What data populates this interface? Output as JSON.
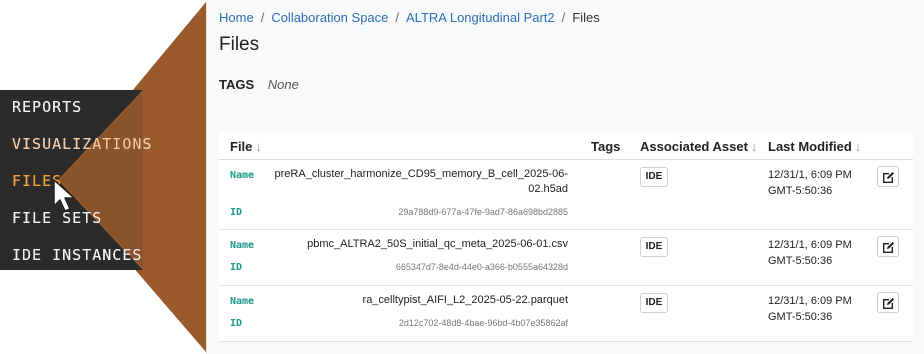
{
  "menu": {
    "items": [
      {
        "label": "REPORTS",
        "state": "normal"
      },
      {
        "label": "VISUALIZATIONS",
        "state": "faded"
      },
      {
        "label": "FILES",
        "state": "active"
      },
      {
        "label": "FILE SETS",
        "state": "normal"
      },
      {
        "label": "IDE INSTANCES",
        "state": "normal"
      }
    ]
  },
  "breadcrumb": {
    "items": [
      "Home",
      "Collaboration Space",
      "ALTRA Longitudinal Part2"
    ],
    "current": "Files",
    "separator": "/"
  },
  "page": {
    "title": "Files",
    "tags_label": "TAGS",
    "tags_value": "None"
  },
  "table": {
    "headers": {
      "file": "File",
      "tags": "Tags",
      "associated_asset": "Associated Asset",
      "last_modified": "Last Modified"
    },
    "sort_icon": "arrow-down",
    "name_label": "Name",
    "id_label": "ID",
    "rows": [
      {
        "name": "preRA_cluster_harmonize_CD95_memory_B_cell_2025-06-02.h5ad",
        "id": "29a788d9-677a-47fe-9ad7-86a698bd2885",
        "asset": "IDE",
        "modified_line1": "12/31/1, 6:09 PM",
        "modified_line2": "GMT-5:50:36"
      },
      {
        "name": "pbmc_ALTRA2_50S_initial_qc_meta_2025-06-01.csv",
        "id": "665347d7-8e4d-44e0-a366-b0555a64328d",
        "asset": "IDE",
        "modified_line1": "12/31/1, 6:09 PM",
        "modified_line2": "GMT-5:50:36"
      },
      {
        "name": "ra_celltypist_AIFI_L2_2025-05-22.parquet",
        "id": "2d12c702-48d8-4bae-96bd-4b07e35862af",
        "asset": "IDE",
        "modified_line1": "12/31/1, 6:09 PM",
        "modified_line2": "GMT-5:50:36"
      }
    ]
  },
  "colors": {
    "link": "#2f6db5",
    "accent_active": "#f4a340",
    "callout_fill": "#f7c59f",
    "callout_dark": "#9a5a2c",
    "field_label": "#1a9a8a",
    "menu_bg": "#2b2b2b"
  }
}
